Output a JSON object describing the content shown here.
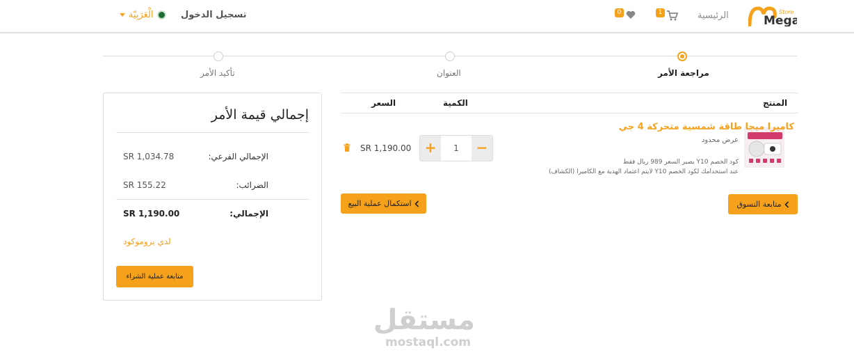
{
  "header": {
    "logo_text": "Mega",
    "logo_sub": "Store",
    "home_label": "الرئيسية",
    "cart_count": "1",
    "wishlist_count": "0",
    "login_label": "تسجيل الدخول",
    "language_label": "الْعَرَبِيّة",
    "accent_color": "#f5a11c"
  },
  "steps": [
    {
      "label": "مراجعة الأمر",
      "active": true
    },
    {
      "label": "العنوان",
      "active": false
    },
    {
      "label": "تأكيد الأمر",
      "active": false
    }
  ],
  "cart": {
    "columns": {
      "product": "المنتج",
      "quantity": "الكمية",
      "price": "السعر"
    },
    "items": [
      {
        "title": "كاميرا ميجا طاقة شمسية متحركة 4 جي",
        "subtitle": "عرض محدود",
        "note_line1": "كود الخصم Y10 يصير السعر 989 ريال فقط",
        "note_line2": "عند استخدامك لكود الخصم Y10 لايتم اعتماد الهدية مع الكاميرا (الكشاف)",
        "quantity": "1",
        "price": "SR 1,190.00"
      }
    ],
    "continue_shopping_label": "متابعة التسوق",
    "checkout_label": "استكمال عملية البيع"
  },
  "summary": {
    "title": "إجمالي قيمة الأمر",
    "subtotal_label": "الإجمالي الفرعي:",
    "subtotal_value": "SR 1,034.78",
    "tax_label": "الضرائب:",
    "tax_value": "SR 155.22",
    "total_label": "الإجمالي:",
    "total_value": "SR 1,190.00",
    "promo_label": "لدي بروموكود",
    "buy_label": "متابعة عملية الشراء"
  },
  "watermark": {
    "arabic": "مستقل",
    "latin": "mostaql.com"
  }
}
